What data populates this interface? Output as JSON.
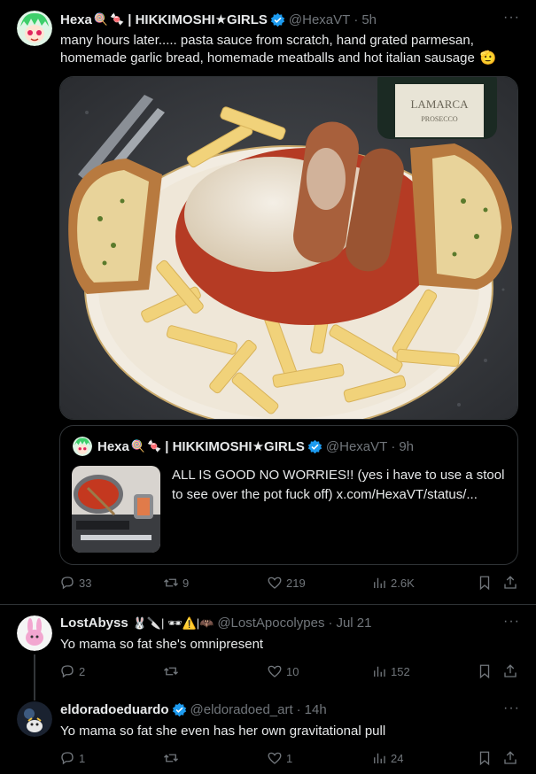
{
  "main_tweet": {
    "name": "Hexa",
    "title_rest": "| HIKKIMOSHI★GIRLS",
    "handle": "@HexaVT",
    "time": "5h",
    "text_line1": "many hours later..... pasta sauce from scratch, hand grated parmesan,",
    "text_line2": "homemade garlic bread, homemade meatballs and hot italian sausage",
    "media_label": "LAMARCA",
    "media_sublabel": "PROSECCO",
    "quote": {
      "name": "Hexa",
      "title_rest": "| HIKKIMOSHI★GIRLS",
      "handle": "@HexaVT",
      "time": "9h",
      "text": "ALL IS GOOD NO WORRIES!! (yes i have to use a stool to see over the pot fuck off)  x.com/HexaVT/status/..."
    },
    "stats": {
      "replies": "33",
      "retweets": "9",
      "likes": "219",
      "views": "2.6K"
    }
  },
  "reply1": {
    "name": "LostAbyss",
    "name_emoji": "🐰🔪| 🕶⚠️|🦇",
    "handle": "@LostApocolypes",
    "time": "Jul 21",
    "text": "Yo mama so fat she's omnipresent",
    "stats": {
      "replies": "2",
      "retweets": "",
      "likes": "10",
      "views": "152"
    }
  },
  "reply2": {
    "name": "eldoradoeduardo",
    "handle": "@eldoradoed_art",
    "time": "14h",
    "text": "Yo mama so fat she even has her own gravitational pull",
    "stats": {
      "replies": "1",
      "retweets": "",
      "likes": "1",
      "views": "24"
    }
  },
  "colors": {
    "accent": "#1d9bf0",
    "muted": "#71767b",
    "border": "#2f3336"
  }
}
